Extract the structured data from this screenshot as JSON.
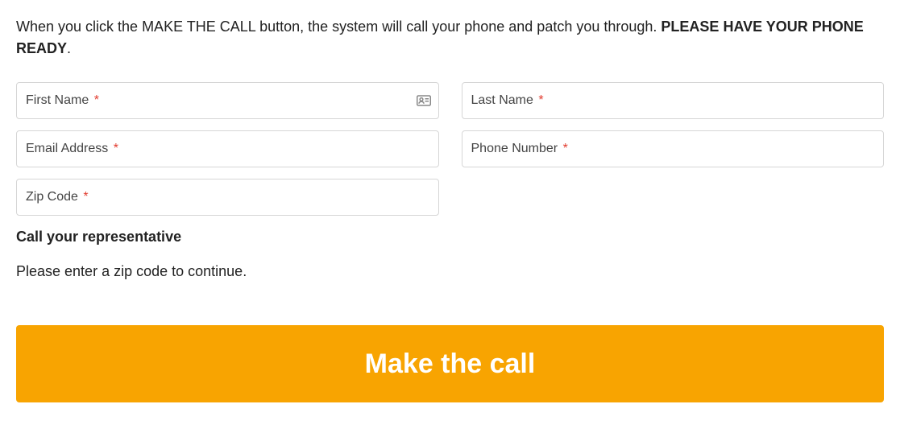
{
  "instruction": {
    "text_normal": "When you click the MAKE THE CALL button, the system will call your phone and patch you through.  ",
    "text_bold": "PLEASE HAVE YOUR PHONE READY",
    "text_period": "."
  },
  "form": {
    "first_name": {
      "label": "First Name",
      "required_mark": "*"
    },
    "last_name": {
      "label": "Last Name",
      "required_mark": "*"
    },
    "email": {
      "label": "Email Address",
      "required_mark": "*"
    },
    "phone": {
      "label": "Phone Number",
      "required_mark": "*"
    },
    "zip": {
      "label": "Zip Code",
      "required_mark": "*"
    }
  },
  "section": {
    "heading": "Call your representative",
    "prompt": "Please enter a zip code to continue."
  },
  "cta": {
    "label": "Make the call"
  }
}
